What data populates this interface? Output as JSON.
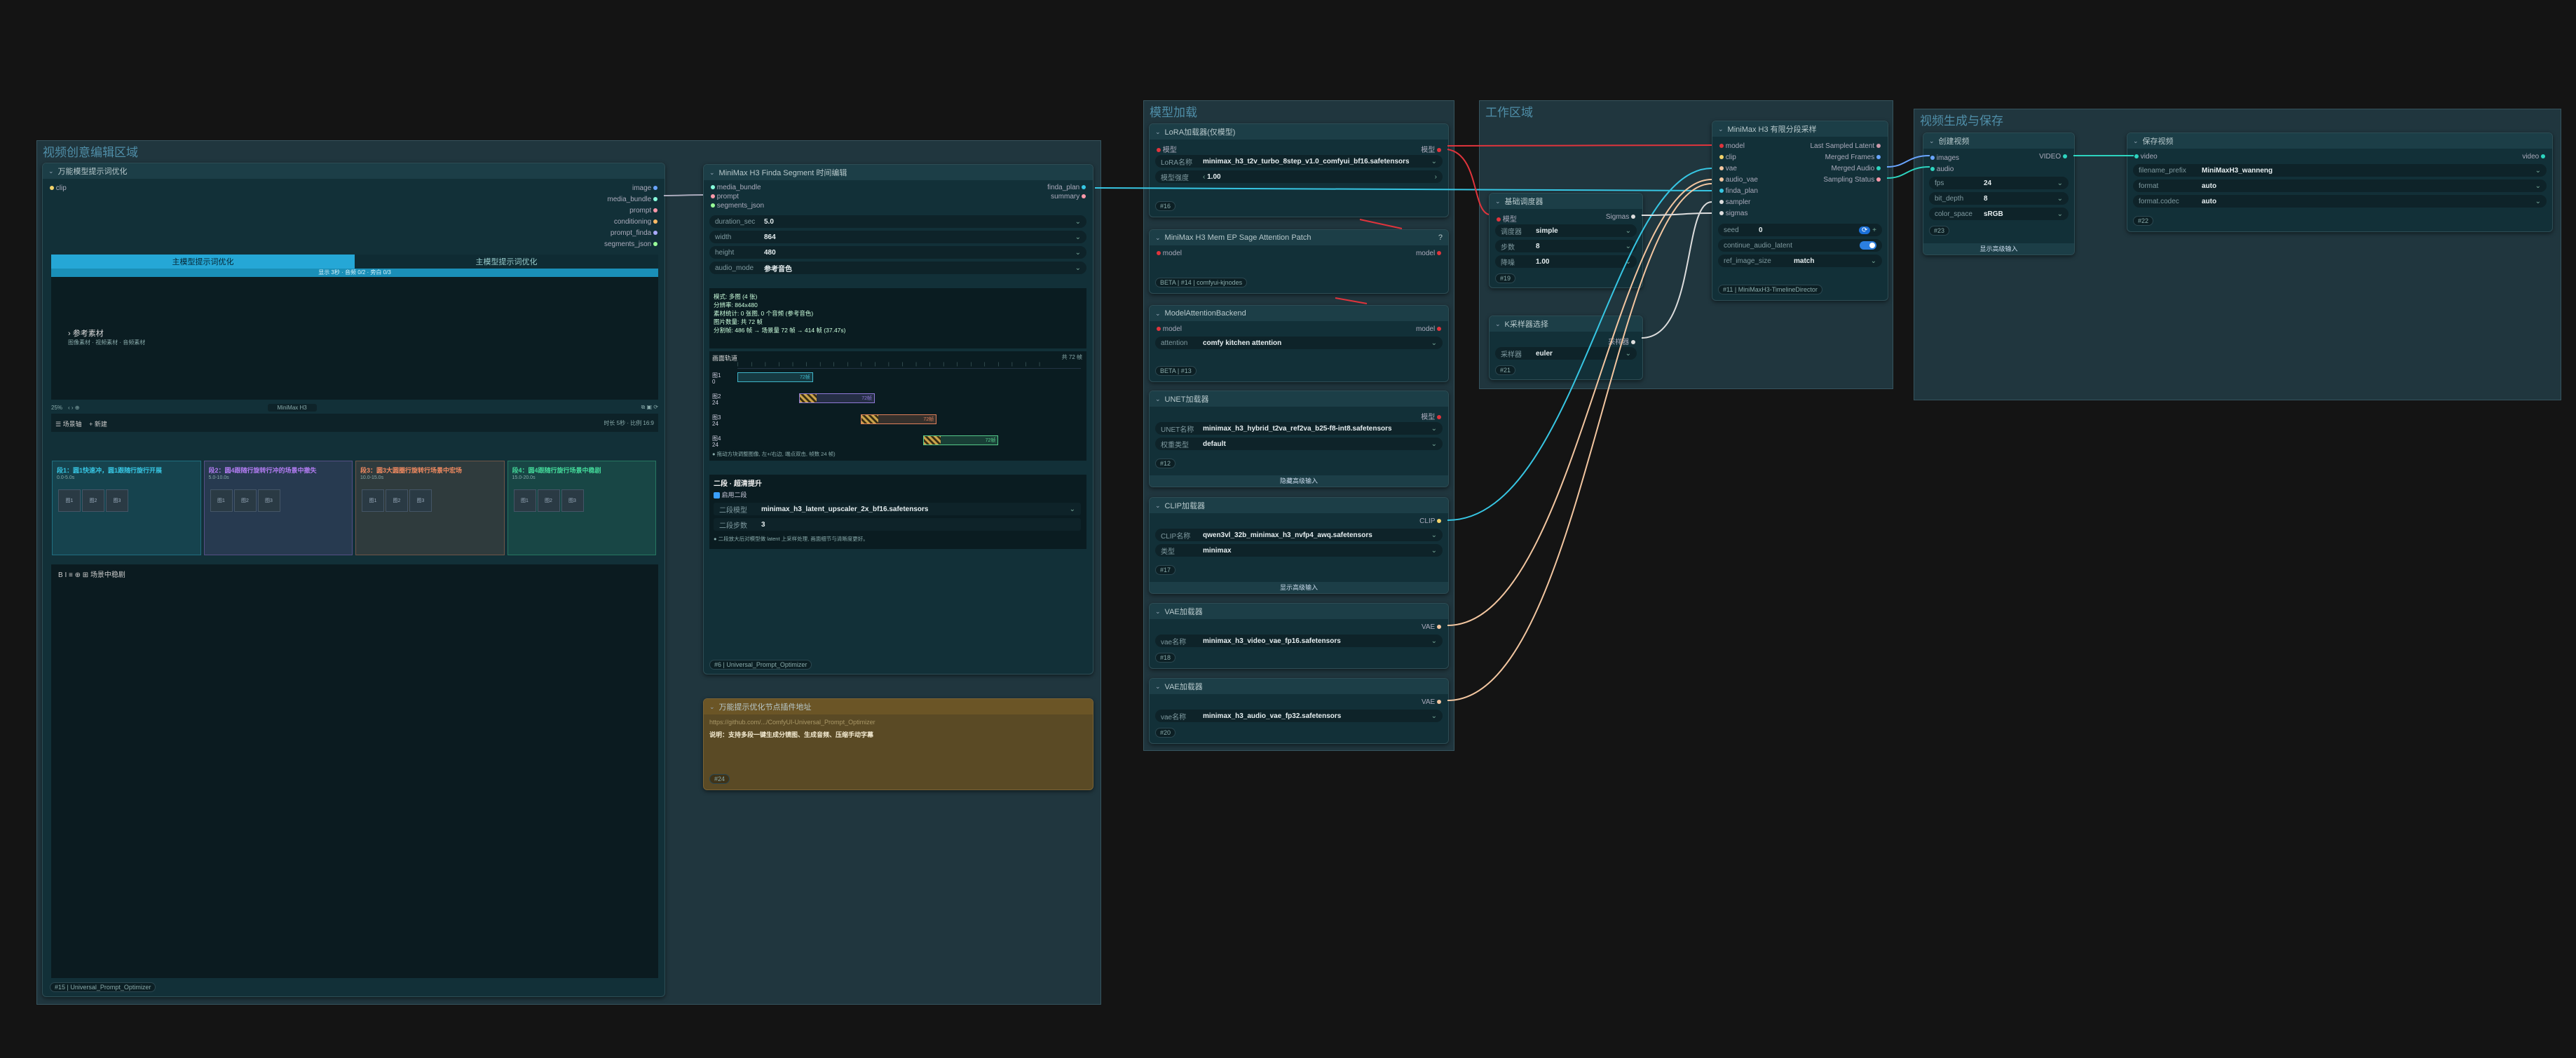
{
  "groups": {
    "video_edit": "视频创意编辑区域",
    "model_load": "模型加载",
    "work": "工作区域",
    "output": "视频生成与保存"
  },
  "prompt_node": {
    "title": "万能模型提示词优化",
    "input_clip": "clip",
    "outputs": [
      "image",
      "media_bundle",
      "prompt",
      "conditioning",
      "prompt_finda",
      "segments_json"
    ],
    "tab_generate": "主模型提示词优化",
    "tab_refine": "主模型提示词优化",
    "tab_sub": "显示 3秒 · 音频 0/2 · 旁白 0/3",
    "ref_label": "参考素材",
    "ref_hint": "图像素材 · 视频素材 · 音频素材",
    "toolbar_zoom": "25%",
    "toolbar_model": "MiniMax H3",
    "timeline_label": "场景轴",
    "timeline_add": "+ 新建",
    "timeline_right": "时长 5秒 · 比例 16:9",
    "scenes": [
      {
        "title": "段1：圆1快速冲，圆1跟随行旋行开展",
        "sub": "0.0-5.0s",
        "color": "#37c6e3"
      },
      {
        "title": "段2：圆4跟随行旋转行冲的场景中撤失",
        "sub": "5.0-10.0s",
        "color": "#b27cf2"
      },
      {
        "title": "段3：圆3大圆圈行旋转行场景中宏场",
        "sub": "10.0-15.0s",
        "color": "#f08a60"
      },
      {
        "title": "段4：圆4跟随行旋行场景中稳剧",
        "sub": "15.0-20.0s",
        "color": "#43d99a"
      }
    ],
    "thumb_labels": [
      "图1",
      "图2",
      "图3"
    ],
    "bottom_title": "场景中稳剧",
    "footer_id": "#15",
    "footer_name": "Universal_Prompt_Optimizer"
  },
  "finda_node": {
    "title": "MiniMax H3 Finda Segment 时间编辑",
    "inputs": [
      "media_bundle",
      "prompt",
      "segments_json"
    ],
    "outputs": [
      "finda_plan",
      "summary"
    ],
    "widgets": [
      {
        "label": "duration_sec",
        "value": "5.0"
      },
      {
        "label": "width",
        "value": "864"
      },
      {
        "label": "height",
        "value": "480"
      },
      {
        "label": "audio_mode",
        "value": "参考音色"
      }
    ],
    "info_lines": [
      "模式: 多图 (4 张)",
      "分辨率: 864x480",
      "素材统计: 0 张图, 0 个音频 (参考音色)",
      "图片数量: 共 72 帧",
      "分割帧: 486 帧 → 场景量 72 帧 → 414 帧 (37.47s)"
    ],
    "track_title": "画面轨道",
    "track_right": "共 72 帧",
    "tracks": [
      {
        "name": "图1",
        "sub": "0",
        "value": "72帧",
        "color": "#3fb5c9"
      },
      {
        "name": "图2",
        "sub": "24",
        "value": "72帧",
        "color": "#8f7ad8"
      },
      {
        "name": "图3",
        "sub": "24",
        "value": "72帧",
        "color": "#e0805a"
      },
      {
        "name": "图4",
        "sub": "24",
        "value": "72帧",
        "color": "#55c98a"
      }
    ],
    "track_hint": "拖动方块调整图像, 左+/右边, 端点双击, 帧数 24 帧)",
    "upscale_title": "二段 · 超清提升",
    "upscale_enable": "启用二段",
    "upscale_model_label": "二段模型",
    "upscale_model": "minimax_h3_latent_upscaler_2x_bf16.safetensors",
    "upscale_steps_label": "二段步数",
    "upscale_steps": "3",
    "upscale_hint": "二段放大后对模型做 latent 上采样处理, 画面细节与清晰度更好。",
    "footer_id": "#6",
    "footer_name": "Universal_Prompt_Optimizer"
  },
  "note_node": {
    "title": "万能提示优化节点插件地址",
    "url": "https://github.com/.../ComfyUI-Universal_Prompt_Optimizer",
    "desc": "说明：支持多段一键生成分镜图、生成音频、压缩手动字幕",
    "footer_id": "#24"
  },
  "lora_node": {
    "title": "LoRA加载器(仅模型)",
    "in": "模型",
    "out": "模型",
    "name_label": "LoRA名称",
    "name": "minimax_h3_t2v_turbo_8step_v1.0_comfyui_bf16.safetensors",
    "strength_label": "模型强度",
    "strength": "1.00",
    "footer_id": "#16"
  },
  "sage_node": {
    "title": "MiniMax H3 Mem EP Sage Attention Patch",
    "in": "model",
    "out": "model",
    "beta": "BETA",
    "id": "#14",
    "source": "comfyui-kjnodes"
  },
  "attn_node": {
    "title": "ModelAttentionBackend",
    "in": "model",
    "out": "model",
    "attn_label": "attention",
    "attn": "comfy kitchen attention",
    "beta": "BETA",
    "id": "#13"
  },
  "unet_node": {
    "title": "UNET加载器",
    "out": "模型",
    "name_label": "UNET名称",
    "name": "minimax_h3_hybrid_t2va_ref2va_b25-f8-int8.safetensors",
    "dtype_label": "权重类型",
    "dtype": "default",
    "footer_id": "#12",
    "toggle": "隐藏高级输入"
  },
  "clip_node": {
    "title": "CLIP加载器",
    "out": "CLIP",
    "name_label": "CLIP名称",
    "name": "qwen3vl_32b_minimax_h3_nvfp4_awq.safetensors",
    "type_label": "类型",
    "type": "minimax",
    "footer_id": "#17",
    "toggle": "显示高级输入"
  },
  "vae1_node": {
    "title": "VAE加载器",
    "out": "VAE",
    "name_label": "vae名称",
    "name": "minimax_h3_video_vae_fp16.safetensors",
    "footer_id": "#18"
  },
  "vae2_node": {
    "title": "VAE加载器",
    "out": "VAE",
    "name_label": "vae名称",
    "name": "minimax_h3_audio_vae_fp32.safetensors",
    "footer_id": "#20"
  },
  "sched_node": {
    "title": "基础调度器",
    "in": "模型",
    "out": "Sigmas",
    "widgets": [
      {
        "label": "调度器",
        "value": "simple"
      },
      {
        "label": "步数",
        "value": "8"
      },
      {
        "label": "降噪",
        "value": "1.00"
      }
    ],
    "footer_id": "#19"
  },
  "ksel_node": {
    "title": "K采样器选择",
    "out": "采样器",
    "label": "采样器",
    "value": "euler",
    "footer_id": "#21"
  },
  "sampler_node": {
    "title": "MiniMax H3 有限分段采样",
    "inputs": [
      "model",
      "clip",
      "vae",
      "audio_vae",
      "finda_plan",
      "sampler",
      "sigmas"
    ],
    "outputs": [
      "Last Sampled Latent",
      "Merged Frames",
      "Merged Audio",
      "Sampling Status"
    ],
    "seed_label": "seed",
    "seed": "0",
    "cont_label": "continue_audio_latent",
    "ref_label": "ref_image_size",
    "ref_value": "match",
    "footer_id": "#11",
    "footer_name": "MiniMaxH3-TimelineDirector"
  },
  "combine_node": {
    "title": "创建视频",
    "inputs": [
      "images",
      "audio"
    ],
    "out": "VIDEO",
    "widgets": [
      {
        "label": "fps",
        "value": "24"
      },
      {
        "label": "bit_depth",
        "value": "8"
      },
      {
        "label": "color_space",
        "value": "sRGB"
      }
    ],
    "footer_id": "#23",
    "toggle": "显示高级输入"
  },
  "save_node": {
    "title": "保存视频",
    "in": "video",
    "out": "video",
    "widgets": [
      {
        "label": "filename_prefix",
        "value": "MiniMaxH3_wanneng"
      },
      {
        "label": "format",
        "value": "auto"
      },
      {
        "label": "format.codec",
        "value": "auto"
      }
    ],
    "footer_id": "#22"
  },
  "colors": {
    "cyan": "#37c6e3",
    "red": "#e0343c",
    "peach": "#f3c6a0",
    "teal": "#2dd4bf"
  }
}
